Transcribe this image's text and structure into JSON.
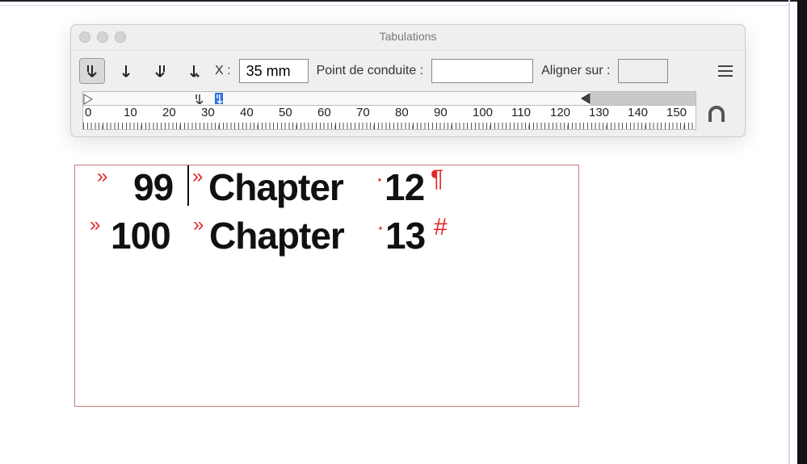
{
  "panel": {
    "title": "Tabulations",
    "x_label": "X :",
    "x_value": "35 mm",
    "leader_label": "Point de conduite :",
    "leader_value": "",
    "align_label": "Aligner sur :",
    "align_value": ""
  },
  "ruler": {
    "numbers": [
      "0",
      "10",
      "20",
      "30",
      "40",
      "50",
      "60",
      "70",
      "80",
      "90",
      "100",
      "110",
      "120",
      "130",
      "140",
      "150"
    ]
  },
  "text": {
    "line1": {
      "num": "99",
      "title": "Chapter",
      "suffix": "12"
    },
    "line2": {
      "num": "100",
      "title": "Chapter",
      "suffix": "13"
    }
  },
  "glyphs": {
    "tab": "»",
    "space": "·",
    "pilcrow": "¶",
    "endstory": "#"
  }
}
